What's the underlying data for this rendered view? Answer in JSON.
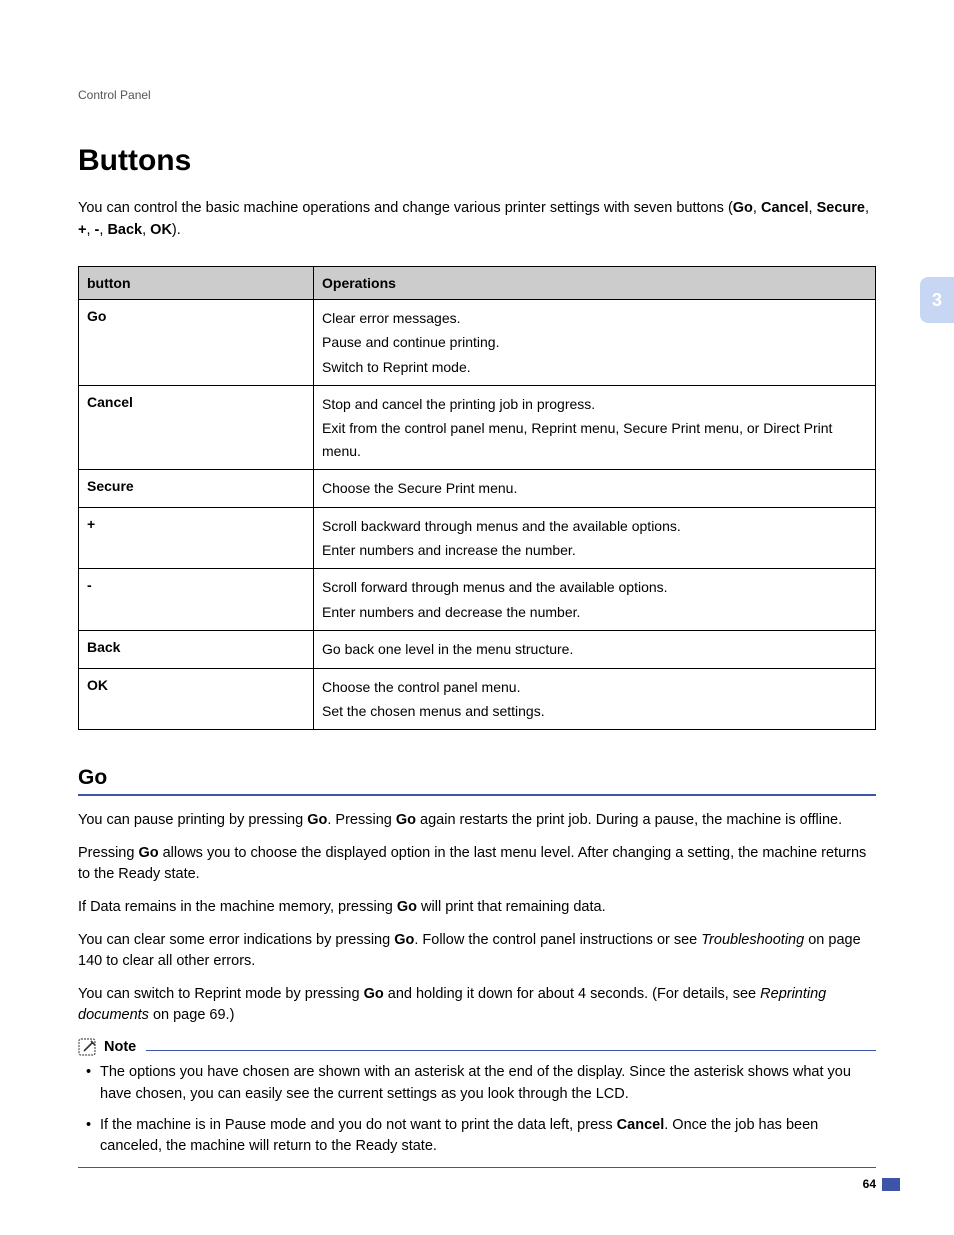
{
  "breadcrumb": "Control Panel",
  "heading": "Buttons",
  "intro": {
    "pre": "You can control the basic machine operations and change various printer settings with seven buttons (",
    "b1": "Go",
    "s1": ", ",
    "b2": "Cancel",
    "s2": ", ",
    "b3": "Secure",
    "s3": ", ",
    "b4": "+",
    "s4": ", ",
    "b5": "-",
    "s5": ", ",
    "b6": "Back",
    "s6": ", ",
    "b7": "OK",
    "s7": ")."
  },
  "table": {
    "h1": "button",
    "h2": "Operations",
    "rows": [
      {
        "button": "Go",
        "ops": [
          "Clear error messages.",
          "Pause and continue printing.",
          "Switch to Reprint mode."
        ]
      },
      {
        "button": "Cancel",
        "ops": [
          "Stop and cancel the printing job in progress.",
          "Exit from the control panel menu, Reprint menu, Secure Print menu, or Direct Print menu."
        ]
      },
      {
        "button": "Secure",
        "ops": [
          "Choose the Secure Print menu."
        ]
      },
      {
        "button": "+",
        "ops": [
          "Scroll backward through menus and the available options.",
          "Enter numbers and increase the number."
        ]
      },
      {
        "button": "-",
        "ops": [
          "Scroll forward through menus and the available options.",
          "Enter numbers and decrease the number."
        ]
      },
      {
        "button": "Back",
        "ops": [
          "Go back one level in the menu structure."
        ]
      },
      {
        "button": "OK",
        "ops": [
          "Choose the control panel menu.",
          "Set the chosen menus and settings."
        ]
      }
    ]
  },
  "section": {
    "heading": "Go",
    "p1": {
      "a": "You can pause printing by pressing ",
      "b1": "Go",
      "b": ". Pressing ",
      "b2": "Go",
      "c": " again restarts the print job. During a pause, the machine is offline."
    },
    "p2": {
      "a": "Pressing ",
      "b1": "Go",
      "b": " allows you to choose the displayed option in the last menu level. After changing a setting, the machine returns to the Ready state."
    },
    "p3": {
      "a": "If Data remains in the machine memory, pressing ",
      "b1": "Go",
      "b": " will print that remaining data."
    },
    "p4": {
      "a": "You can clear some error indications by pressing ",
      "b1": "Go",
      "b": ". Follow the control panel instructions or see ",
      "i1": "Troubleshooting",
      "c": " on page 140 to clear all other errors."
    },
    "p5": {
      "a": "You can switch to Reprint mode by pressing ",
      "b1": "Go",
      "b": " and holding it down for about 4 seconds. (For details, see ",
      "i1": "Reprinting documents",
      "c": " on page 69.)"
    }
  },
  "note": {
    "title": "Note",
    "items": [
      {
        "text": "The options you have chosen are shown with an asterisk at the end of the display. Since the asterisk shows what you have chosen, you can easily see the current settings as you look through the LCD."
      },
      {
        "a": "If the machine is in Pause mode and you do not want to print the data left, press ",
        "b1": "Cancel",
        "b": ". Once the job has been canceled, the machine will return to the Ready state."
      }
    ]
  },
  "sidetab": "3",
  "pagenum": "64"
}
